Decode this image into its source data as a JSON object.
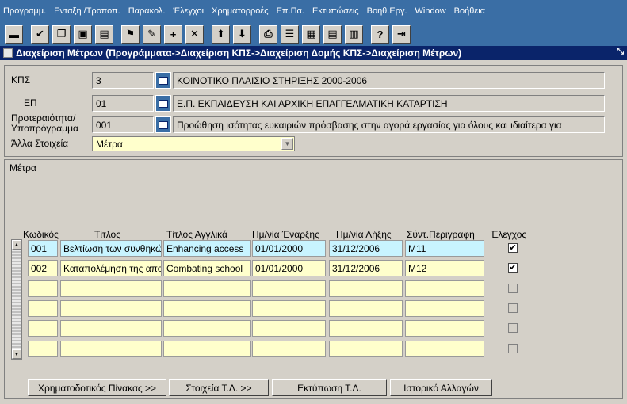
{
  "menu": [
    "Προγραμμ.",
    "Ενταξη /Τροποπ.",
    "Παρακολ.",
    "Έλεγχοι",
    "Χρηματορροές",
    "Επ.Πα.",
    "Εκτυπώσεις",
    "Βοηθ.Εργ.",
    "Window",
    "Βοήθεια"
  ],
  "toolbar": [
    {
      "name": "save-icon",
      "glyph": "▬"
    },
    {
      "name": "check-icon",
      "glyph": "✔"
    },
    {
      "name": "copy-record-icon",
      "glyph": "❐"
    },
    {
      "name": "clear-record-icon",
      "glyph": "▣"
    },
    {
      "name": "duplicate-icon",
      "glyph": "▤"
    },
    {
      "name": "query-icon",
      "glyph": "⚑"
    },
    {
      "name": "edit-icon",
      "glyph": "✎"
    },
    {
      "name": "insert-record-icon",
      "glyph": "+"
    },
    {
      "name": "delete-record-icon",
      "glyph": "✕"
    },
    {
      "name": "arrow-up-icon",
      "glyph": "⬆"
    },
    {
      "name": "arrow-down-icon",
      "glyph": "⬇"
    },
    {
      "name": "print-icon",
      "glyph": "⎙"
    },
    {
      "name": "list-icon",
      "glyph": "☰"
    },
    {
      "name": "form-icon",
      "glyph": "▦"
    },
    {
      "name": "document-icon",
      "glyph": "▤"
    },
    {
      "name": "clipboard-icon",
      "glyph": "▥"
    },
    {
      "name": "help-icon",
      "glyph": "?"
    },
    {
      "name": "exit-icon",
      "glyph": "⇥"
    }
  ],
  "window_title": "Διαχείριση Μέτρων (Προγράμματα->Διαχείριση ΚΠΣ->Διαχείριση Δομής ΚΠΣ->Διαχείριση Μέτρων)",
  "header": {
    "kps_label": "ΚΠΣ",
    "kps_code": "3",
    "kps_desc": "ΚΟΙΝΟΤΙΚΟ ΠΛΑΙΣΙΟ ΣΤΗΡΙΞΗΣ 2000-2006",
    "ep_label": "ΕΠ",
    "ep_code": "01",
    "ep_desc": "Ε.Π. ΕΚΠΑΙΔΕΥΣΗ ΚΑΙ ΑΡΧΙΚΗ ΕΠΑΓΓΕΛΜΑΤΙΚΗ ΚΑΤΑΡΤΙΣΗ",
    "priority_label_1": "Προτεραιότητα/",
    "priority_label_2": "Υποπρόγραμμα",
    "priority_code": "001",
    "priority_desc": "Προώθηση ισότητας ευκαιριών πρόσβασης στην αγορά εργασίας για όλους και ιδιαίτερα για",
    "other_label": "Άλλα Στοιχεία",
    "other_value": "Μέτρα"
  },
  "block_title": "Μέτρα",
  "columns": {
    "code": "Κωδικός",
    "title": "Τίτλος",
    "title_en": "Τίτλος Αγγλικά",
    "start": "Ημ/νία Έναρξης",
    "end": "Ημ/νία Λήξης",
    "short": "Σύντ.Περιγραφή",
    "check": "Έλεγχος"
  },
  "rows": [
    {
      "code": "001",
      "title": "Βελτίωση των συνθηκών",
      "title_en": "Enhancing access",
      "start": "01/01/2000",
      "end": "31/12/2006",
      "short": "M11",
      "checked": "✔"
    },
    {
      "code": "002",
      "title": "Καταπολέμηση της αποχής",
      "title_en": "Combating school",
      "start": "01/01/2000",
      "end": "31/12/2006",
      "short": "M12",
      "checked": "✔"
    },
    {
      "code": "",
      "title": "",
      "title_en": "",
      "start": "",
      "end": "",
      "short": "",
      "checked": ""
    },
    {
      "code": "",
      "title": "",
      "title_en": "",
      "start": "",
      "end": "",
      "short": "",
      "checked": ""
    },
    {
      "code": "",
      "title": "",
      "title_en": "",
      "start": "",
      "end": "",
      "short": "",
      "checked": ""
    },
    {
      "code": "",
      "title": "",
      "title_en": "",
      "start": "",
      "end": "",
      "short": "",
      "checked": ""
    }
  ],
  "buttons": {
    "funding": "Χρηματοδοτικός Πίνακας >>",
    "td": "Στοιχεία Τ.Δ. >>",
    "print_td": "Εκτύπωση Τ.Δ.",
    "history": "Ιστορικό Αλλαγών"
  }
}
